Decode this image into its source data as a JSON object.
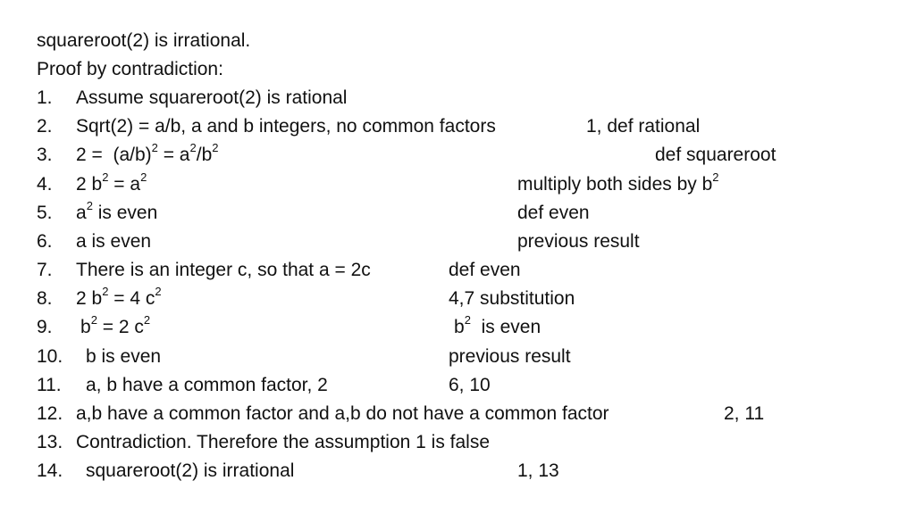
{
  "slide": {
    "title": "squareroot(2) is irrational.",
    "subtitle": "Proof by contradiction:",
    "steps": [
      {
        "number": "1.",
        "statement": "Assume squareroot(2) is rational",
        "justification": ""
      },
      {
        "number": "2.",
        "statement": "Sqrt(2) = a/b, a and b integers, no common factors",
        "justification": "1, def rational"
      },
      {
        "number": "3.",
        "statement_parts": [
          "2 =  (a/b)",
          "2",
          " = a",
          "2",
          "/b",
          "2"
        ],
        "justification": "def squareroot"
      },
      {
        "number": "4.",
        "statement_parts": [
          "2 b",
          "2",
          " = a",
          "2"
        ],
        "justification_parts": [
          "multiply both sides by b",
          "2"
        ]
      },
      {
        "number": "5.",
        "statement_parts": [
          "a",
          "2",
          " is even"
        ],
        "justification": "def even"
      },
      {
        "number": "6.",
        "statement": "a is even",
        "justification": "previous result"
      },
      {
        "number": "7.",
        "statement": "There is an integer c, so that a = 2c",
        "justification": "def even"
      },
      {
        "number": "8.",
        "statement_parts": [
          "2 b",
          "2",
          " = 4 c",
          "2"
        ],
        "justification": "4,7 substitution"
      },
      {
        "number": "9.",
        "statement_parts": [
          "b",
          "2",
          " = 2 c",
          "2"
        ],
        "justification_parts": [
          "b",
          "2",
          "  is even"
        ]
      },
      {
        "number": "10.",
        "statement": "b is even",
        "justification": "previous result"
      },
      {
        "number": "11.",
        "statement": "a, b have a common factor, 2",
        "justification": "6, 10"
      },
      {
        "number": "12.",
        "statement": "a,b have a common factor and a,b do not have a common factor",
        "justification": "2, 11"
      },
      {
        "number": "13.",
        "statement": "Contradiction. Therefore the assumption 1 is false",
        "justification": ""
      },
      {
        "number": "14.",
        "statement": "squareroot(2) is irrational",
        "justification": "1, 13"
      }
    ]
  }
}
